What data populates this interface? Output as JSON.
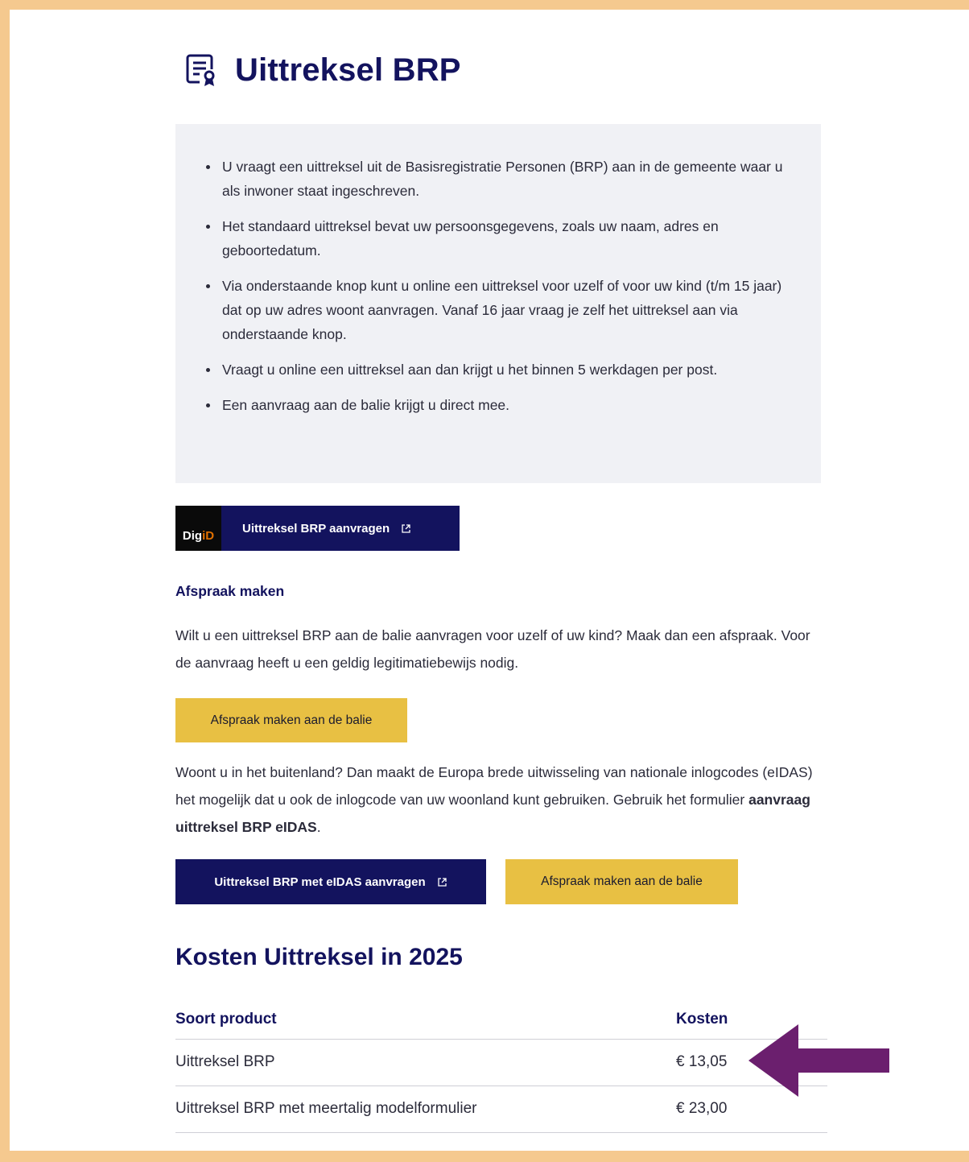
{
  "page": {
    "title": "Uittreksel BRP"
  },
  "info": {
    "items": [
      "U vraagt een uittreksel uit de Basisregistratie Personen (BRP) aan in de gemeente waar u als inwoner staat ingeschreven.",
      "Het standaard uittreksel bevat uw persoonsgegevens, zoals uw naam, adres en geboortedatum.",
      "Via onderstaande knop kunt u online een uittreksel voor uzelf of voor uw kind (t/m 15 jaar) dat op uw adres woont aanvragen. Vanaf 16 jaar vraag je zelf het uittreksel aan via onderstaande knop.",
      "Vraagt u online een uittreksel aan dan krijgt u het binnen 5 werkdagen per post.",
      "Een aanvraag aan de balie krijgt u direct mee."
    ]
  },
  "digid": {
    "logo_part1": "Dig",
    "logo_part2": "iD",
    "button_label": "Uittreksel BRP aanvragen"
  },
  "appointment": {
    "heading": "Afspraak maken",
    "text": "Wilt u een uittreksel BRP aan de balie aanvragen voor uzelf of uw kind? Maak dan een afspraak. Voor de aanvraag heeft u een geldig legitimatiebewijs nodig.",
    "button_label": "Afspraak maken aan de balie"
  },
  "abroad": {
    "text_before": "Woont u in het buitenland? Dan maakt de Europa brede uitwisseling van nationale inlogcodes (eIDAS) het mogelijk dat u ook de inlogcode van uw woonland kunt gebruiken. Gebruik het formulier ",
    "text_bold": "aanvraag uittreksel BRP eIDAS",
    "text_after": ".",
    "eidas_button_label": "Uittreksel BRP met eIDAS aanvragen",
    "balie_button_label": "Afspraak maken aan de balie"
  },
  "costs": {
    "title": "Kosten Uittreksel in 2025",
    "headers": [
      "Soort product",
      "Kosten"
    ],
    "rows": [
      {
        "product": "Uittreksel BRP",
        "price": "€ 13,05"
      },
      {
        "product": "Uittreksel BRP met meertalig modelformulier",
        "price": "€ 23,00"
      }
    ]
  },
  "colors": {
    "navy": "#13135e",
    "yellow": "#e8c043",
    "frame": "#f5c98f",
    "arrow": "#6b1f6e"
  },
  "icons": {
    "title_icon": "certificate-document-icon",
    "external_icon": "external-link-icon",
    "annotation": "arrow-left-icon"
  }
}
